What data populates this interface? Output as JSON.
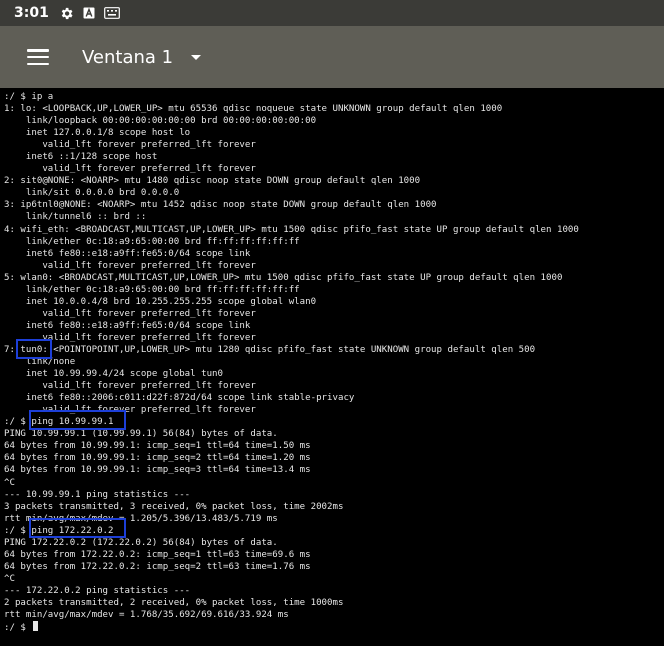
{
  "status_bar": {
    "time": "3:01",
    "icons": [
      "gear-icon",
      "font-a-icon",
      "keyboard-icon"
    ]
  },
  "toolbar": {
    "menu_icon": "hamburger-menu-icon",
    "title": "Ventana 1",
    "dropdown_icon": "dropdown-arrow-icon"
  },
  "terminal": {
    "lines": [
      ":/ $ ip a",
      "1: lo: <LOOPBACK,UP,LOWER_UP> mtu 65536 qdisc noqueue state UNKNOWN group default qlen 1000",
      "    link/loopback 00:00:00:00:00:00 brd 00:00:00:00:00:00",
      "    inet 127.0.0.1/8 scope host lo",
      "       valid_lft forever preferred_lft forever",
      "    inet6 ::1/128 scope host",
      "       valid_lft forever preferred_lft forever",
      "2: sit0@NONE: <NOARP> mtu 1480 qdisc noop state DOWN group default qlen 1000",
      "    link/sit 0.0.0.0 brd 0.0.0.0",
      "3: ip6tnl0@NONE: <NOARP> mtu 1452 qdisc noop state DOWN group default qlen 1000",
      "    link/tunnel6 :: brd ::",
      "4: wifi_eth: <BROADCAST,MULTICAST,UP,LOWER_UP> mtu 1500 qdisc pfifo_fast state UP group default qlen 1000",
      "    link/ether 0c:18:a9:65:00:00 brd ff:ff:ff:ff:ff:ff",
      "    inet6 fe80::e18:a9ff:fe65:0/64 scope link",
      "       valid_lft forever preferred_lft forever",
      "5: wlan0: <BROADCAST,MULTICAST,UP,LOWER_UP> mtu 1500 qdisc pfifo_fast state UP group default qlen 1000",
      "    link/ether 0c:18:a9:65:00:00 brd ff:ff:ff:ff:ff:ff",
      "    inet 10.0.0.4/8 brd 10.255.255.255 scope global wlan0",
      "       valid_lft forever preferred_lft forever",
      "    inet6 fe80::e18:a9ff:fe65:0/64 scope link",
      "       valid_lft forever preferred_lft forever",
      "7: tun0: <POINTOPOINT,UP,LOWER_UP> mtu 1280 qdisc pfifo_fast state UNKNOWN group default qlen 500",
      "    link/none",
      "    inet 10.99.99.4/24 scope global tun0",
      "       valid_lft forever preferred_lft forever",
      "    inet6 fe80::2006:c011:d22f:872d/64 scope link stable-privacy",
      "       valid_lft forever preferred_lft forever",
      ":/ $ ping 10.99.99.1",
      "PING 10.99.99.1 (10.99.99.1) 56(84) bytes of data.",
      "64 bytes from 10.99.99.1: icmp_seq=1 ttl=64 time=1.50 ms",
      "64 bytes from 10.99.99.1: icmp_seq=2 ttl=64 time=1.20 ms",
      "64 bytes from 10.99.99.1: icmp_seq=3 ttl=64 time=13.4 ms",
      "^C",
      "--- 10.99.99.1 ping statistics ---",
      "3 packets transmitted, 3 received, 0% packet loss, time 2002ms",
      "rtt min/avg/max/mdev = 1.205/5.396/13.483/5.719 ms",
      ":/ $ ping 172.22.0.2",
      "PING 172.22.0.2 (172.22.0.2) 56(84) bytes of data.",
      "64 bytes from 172.22.0.2: icmp_seq=1 ttl=63 time=69.6 ms",
      "64 bytes from 172.22.0.2: icmp_seq=2 ttl=63 time=1.76 ms",
      "^C",
      "--- 172.22.0.2 ping statistics ---",
      "2 packets transmitted, 2 received, 0% packet loss, time 1000ms",
      "rtt min/avg/max/mdev = 1.768/35.692/69.616/33.924 ms",
      ":/ $ "
    ],
    "highlight_color": "#1d3fd8"
  }
}
